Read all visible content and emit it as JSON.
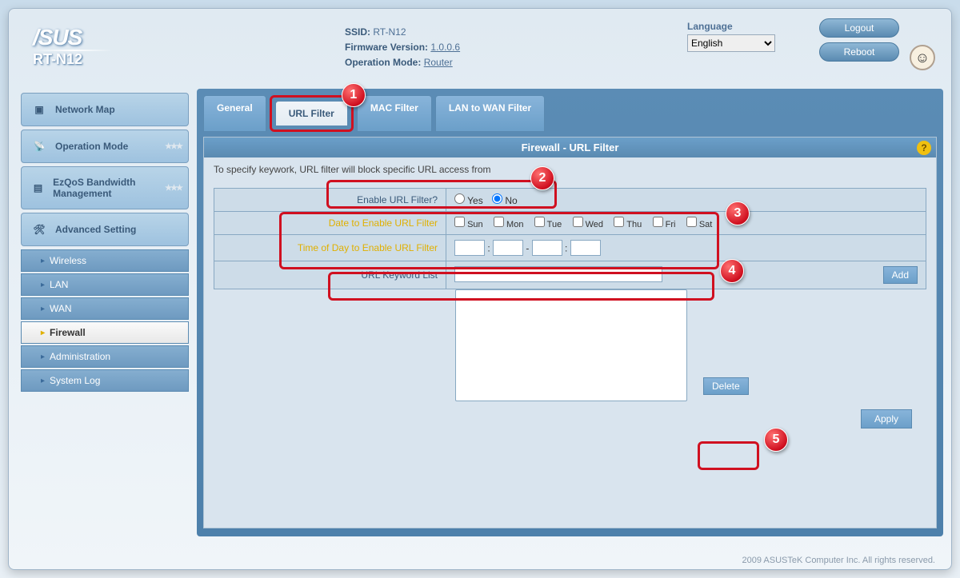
{
  "header": {
    "brand": "/SUS",
    "model": "RT-N12",
    "ssid_label": "SSID:",
    "ssid_value": "RT-N12",
    "fw_label": "Firmware Version:",
    "fw_value": "1.0.0.6",
    "mode_label": "Operation Mode:",
    "mode_value": "Router",
    "lang_label": "Language",
    "lang_value": "English",
    "logout": "Logout",
    "reboot": "Reboot"
  },
  "sidebar": {
    "items": [
      "Network Map",
      "Operation Mode",
      "EzQoS Bandwidth Management",
      "Advanced Setting"
    ],
    "subs": [
      "Wireless",
      "LAN",
      "WAN",
      "Firewall",
      "Administration",
      "System Log"
    ]
  },
  "tabs": [
    "General",
    "URL Filter",
    "MAC Filter",
    "LAN to WAN Filter"
  ],
  "panel": {
    "title": "Firewall - URL Filter",
    "desc": "To specify keywork, URL filter will block specific URL access from",
    "enable_label": "Enable URL Filter?",
    "yes": "Yes",
    "no": "No",
    "date_label": "Date to Enable URL Filter",
    "days": [
      "Sun",
      "Mon",
      "Tue",
      "Wed",
      "Thu",
      "Fri",
      "Sat"
    ],
    "time_label": "Time of Day to Enable URL Filter",
    "keyword_label": "URL Keyword List",
    "add": "Add",
    "delete": "Delete",
    "apply": "Apply"
  },
  "badges": [
    "1",
    "2",
    "3",
    "4",
    "5"
  ],
  "footer": "2009 ASUSTeK Computer Inc. All rights reserved."
}
